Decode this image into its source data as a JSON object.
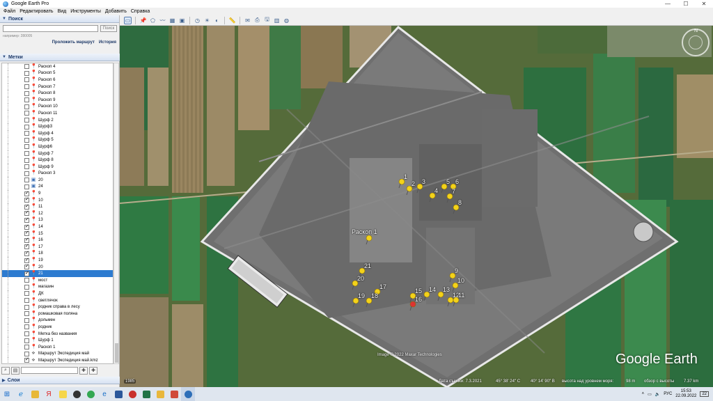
{
  "window": {
    "title": "Google Earth Pro",
    "controls": [
      "—",
      "☐",
      "✕"
    ]
  },
  "menu": [
    "Файл",
    "Редактировать",
    "Вид",
    "Инструменты",
    "Добавить",
    "Справка"
  ],
  "search": {
    "header": "Поиск",
    "placeholder": "",
    "button": "Поиск",
    "hint": "например: 280005",
    "route_link": "Проложить маршрут",
    "history_link": "История"
  },
  "places": {
    "header": "Метки",
    "items": [
      {
        "label": "Раскоп 4",
        "checked": false,
        "icon": "pin-yellow"
      },
      {
        "label": "Раскоп 5",
        "checked": false,
        "icon": "pin-yellow"
      },
      {
        "label": "Раскоп 6",
        "checked": false,
        "icon": "pin-yellow"
      },
      {
        "label": "Раскоп 7",
        "checked": false,
        "icon": "pin-yellow"
      },
      {
        "label": "Раскоп 8",
        "checked": false,
        "icon": "pin-yellow"
      },
      {
        "label": "Раскоп 9",
        "checked": false,
        "icon": "pin-yellow"
      },
      {
        "label": "Раскоп 10",
        "checked": false,
        "icon": "pin-yellow"
      },
      {
        "label": "Раскоп 11",
        "checked": false,
        "icon": "pin-yellow"
      },
      {
        "label": "Шурф 2",
        "checked": false,
        "icon": "pin-green"
      },
      {
        "label": "Шурф3",
        "checked": false,
        "icon": "pin-green"
      },
      {
        "label": "Шурф 4",
        "checked": false,
        "icon": "pin-green"
      },
      {
        "label": "Шурф 5",
        "checked": false,
        "icon": "pin-green"
      },
      {
        "label": "Шурф6",
        "checked": false,
        "icon": "pin-green"
      },
      {
        "label": "Шурф 7",
        "checked": false,
        "icon": "pin-green"
      },
      {
        "label": "Шурф 8",
        "checked": false,
        "icon": "pin-green"
      },
      {
        "label": "Шурф 9",
        "checked": false,
        "icon": "pin-green"
      },
      {
        "label": "Раскоп 3",
        "checked": false,
        "icon": "pin-yellow"
      },
      {
        "label": "20",
        "checked": false,
        "icon": "pin-img"
      },
      {
        "label": "24",
        "checked": false,
        "icon": "pin-img"
      },
      {
        "label": "9",
        "checked": true,
        "icon": "pin-yellow"
      },
      {
        "label": "10",
        "checked": true,
        "icon": "pin-yellow"
      },
      {
        "label": "11",
        "checked": true,
        "icon": "pin-yellow"
      },
      {
        "label": "12",
        "checked": true,
        "icon": "pin-yellow"
      },
      {
        "label": "13",
        "checked": true,
        "icon": "pin-yellow"
      },
      {
        "label": "14",
        "checked": true,
        "icon": "pin-yellow"
      },
      {
        "label": "15",
        "checked": true,
        "icon": "pin-yellow"
      },
      {
        "label": "16",
        "checked": true,
        "icon": "pin-red"
      },
      {
        "label": "17",
        "checked": true,
        "icon": "pin-yellow"
      },
      {
        "label": "18",
        "checked": true,
        "icon": "pin-yellow"
      },
      {
        "label": "19",
        "checked": true,
        "icon": "pin-yellow"
      },
      {
        "label": "20",
        "checked": true,
        "icon": "pin-yellow"
      },
      {
        "label": "21",
        "checked": true,
        "icon": "pin-yellow",
        "selected": true
      },
      {
        "label": "мост",
        "checked": false,
        "icon": "pin-yellow"
      },
      {
        "label": "магазин",
        "checked": false,
        "icon": "pin-yellow"
      },
      {
        "label": "ДК",
        "checked": false,
        "icon": "pin-yellow"
      },
      {
        "label": "светлячок",
        "checked": false,
        "icon": "pin-yellow"
      },
      {
        "label": "родник справа в лесу",
        "checked": false,
        "icon": "pin-yellow"
      },
      {
        "label": "ромашковая поляна",
        "checked": false,
        "icon": "pin-yellow"
      },
      {
        "label": "дольмен",
        "checked": false,
        "icon": "pin-yellow"
      },
      {
        "label": "родник",
        "checked": false,
        "icon": "pin-yellow"
      },
      {
        "label": "Метка без названия",
        "checked": false,
        "icon": "pin-yellow"
      },
      {
        "label": "Шурф 1",
        "checked": false,
        "icon": "pin-yellow"
      },
      {
        "label": "Раскоп 1",
        "checked": false,
        "icon": "pin-yellow"
      },
      {
        "label": "Маршрут Экспедиция май",
        "checked": false,
        "icon": "route"
      },
      {
        "label": "Маршрут Экспедиция май.kmz",
        "checked": true,
        "icon": "route"
      }
    ]
  },
  "layers": {
    "header": "Слои"
  },
  "map": {
    "markers": [
      {
        "label": "1"
      },
      {
        "label": "2"
      },
      {
        "label": "3"
      },
      {
        "label": "4"
      },
      {
        "label": "5"
      },
      {
        "label": "6"
      },
      {
        "label": "7"
      },
      {
        "label": "8"
      },
      {
        "label": "Раскоп 1"
      },
      {
        "label": "21"
      },
      {
        "label": "20"
      },
      {
        "label": "17"
      },
      {
        "label": "19"
      },
      {
        "label": "18"
      },
      {
        "label": "15"
      },
      {
        "label": "16"
      },
      {
        "label": "14"
      },
      {
        "label": "13"
      },
      {
        "label": "12"
      },
      {
        "label": "11"
      },
      {
        "label": "9"
      },
      {
        "label": "10"
      }
    ],
    "copyright": "Image © 2022 Maxar Technologies",
    "logo": "Google Earth",
    "history_year": "1985"
  },
  "status": {
    "imagery_date": "Дата съемки: 7.3.2021",
    "coords": "45° 38' 24\" С",
    "lon": "40° 14' 90\" В",
    "elevation": "высота над уровнем моря:",
    "elevation_value": "98 m",
    "eye_alt": "обзор с высоты",
    "eye_alt_value": "7.37 km"
  },
  "taskbar": {
    "lang": "РУС",
    "time": "15:53",
    "date": "22.09.2022",
    "notif": "22"
  },
  "colors": {
    "accent": "#2d7bd0",
    "header": "#1f3a68",
    "taskbar": "#dfe6ef"
  }
}
